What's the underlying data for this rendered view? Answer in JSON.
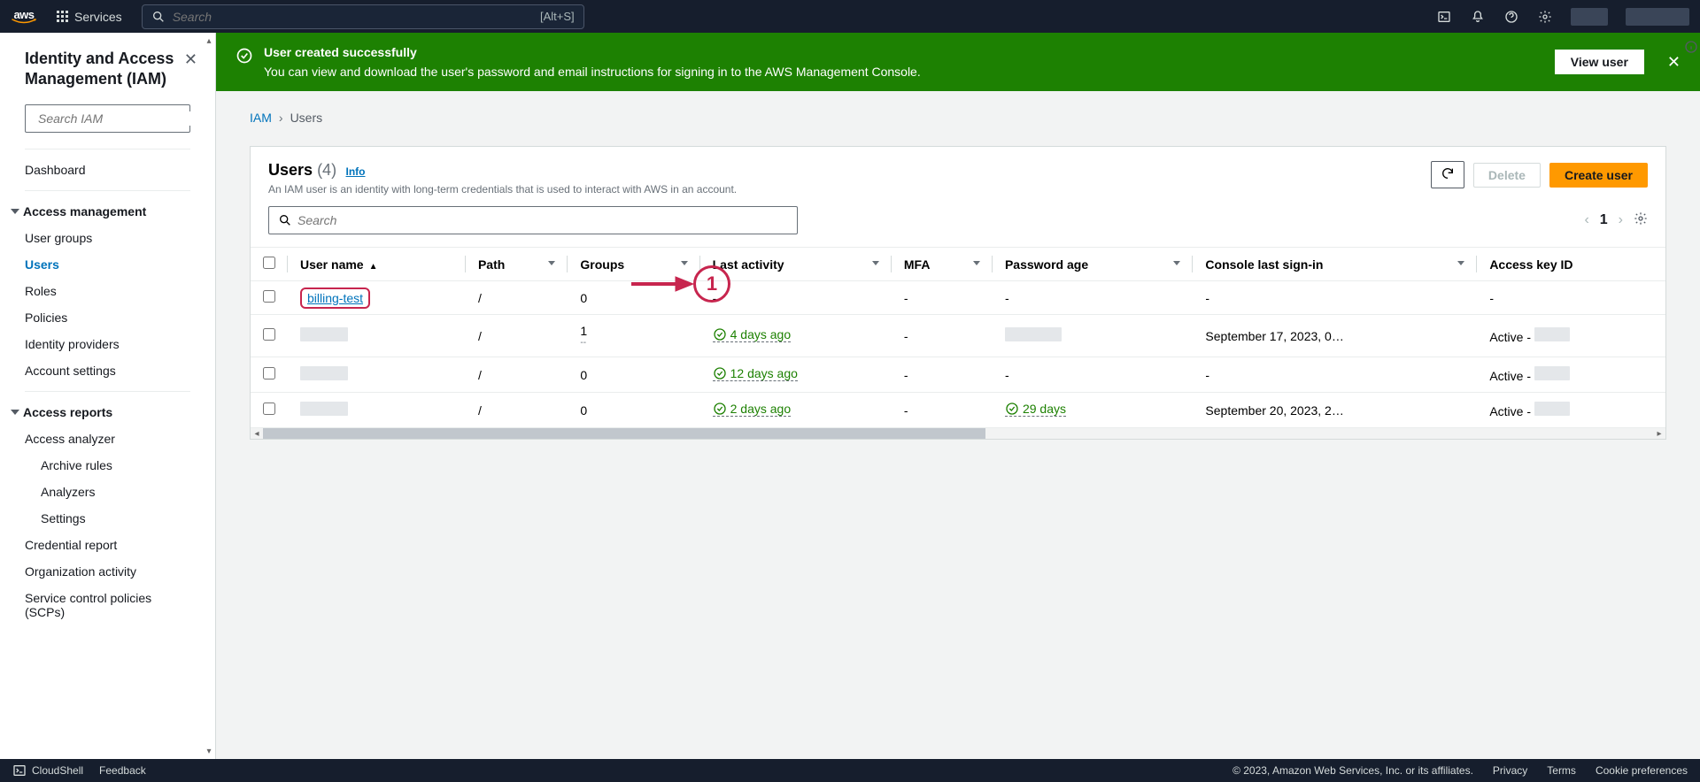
{
  "topnav": {
    "services_label": "Services",
    "search_placeholder": "Search",
    "search_hint": "[Alt+S]"
  },
  "sidebar": {
    "title": "Identity and Access Management (IAM)",
    "search_placeholder": "Search IAM",
    "dashboard": "Dashboard",
    "group_access": "Access management",
    "items_access": [
      "User groups",
      "Users",
      "Roles",
      "Policies",
      "Identity providers",
      "Account settings"
    ],
    "group_reports": "Access reports",
    "analyzer": "Access analyzer",
    "analyzer_sub": [
      "Archive rules",
      "Analyzers",
      "Settings"
    ],
    "items_reports": [
      "Credential report",
      "Organization activity",
      "Service control policies (SCPs)"
    ]
  },
  "banner": {
    "title": "User created successfully",
    "text": "You can view and download the user's password and email instructions for signing in to the AWS Management Console.",
    "button": "View user"
  },
  "breadcrumb": {
    "root": "IAM",
    "current": "Users"
  },
  "panel": {
    "title": "Users",
    "count": "(4)",
    "info": "Info",
    "subtitle": "An IAM user is an identity with long-term credentials that is used to interact with AWS in an account.",
    "refresh": "Refresh",
    "delete": "Delete",
    "create": "Create user",
    "search_placeholder": "Search",
    "page": "1"
  },
  "table": {
    "columns": [
      "User name",
      "Path",
      "Groups",
      "Last activity",
      "MFA",
      "Password age",
      "Console last sign-in",
      "Access key ID"
    ],
    "rows": [
      {
        "user": "billing-test",
        "path": "/",
        "groups": "0",
        "activity": "-",
        "mfa": "-",
        "pwd": "-",
        "signin": "-",
        "key": "-",
        "highlight": true
      },
      {
        "user": "",
        "path": "/",
        "groups": "1",
        "groups_sub": "--",
        "activity": "4 days ago",
        "activity_ok": true,
        "mfa": "-",
        "pwd": "",
        "pwd_redact": true,
        "signin": "September 17, 2023, 0…",
        "key": "Active -",
        "key_redact": true
      },
      {
        "user": "",
        "path": "/",
        "groups": "0",
        "activity": "12 days ago",
        "activity_ok": true,
        "mfa": "-",
        "pwd": "-",
        "signin": "-",
        "key": "Active -",
        "key_redact": true
      },
      {
        "user": "",
        "path": "/",
        "groups": "0",
        "activity": "2 days ago",
        "activity_ok": true,
        "mfa": "-",
        "pwd": "29 days",
        "pwd_ok": true,
        "signin": "September 20, 2023, 2…",
        "key": "Active -",
        "key_redact": true
      }
    ]
  },
  "annotation": {
    "number": "1"
  },
  "footer": {
    "cloudshell": "CloudShell",
    "feedback": "Feedback",
    "copyright": "© 2023, Amazon Web Services, Inc. or its affiliates.",
    "links": [
      "Privacy",
      "Terms",
      "Cookie preferences"
    ]
  }
}
